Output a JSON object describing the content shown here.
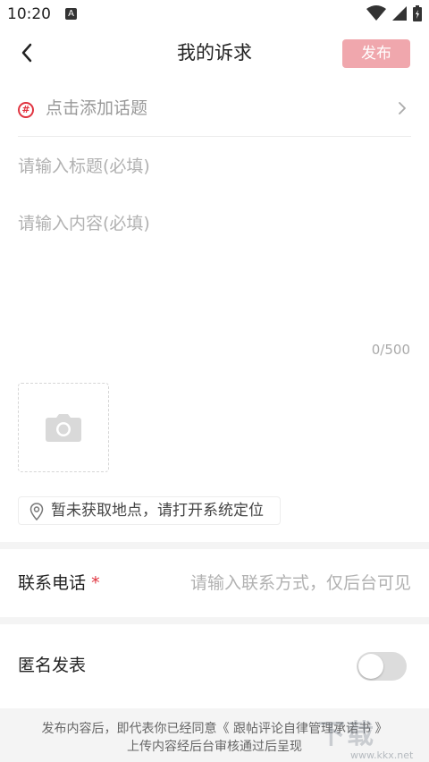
{
  "status_bar": {
    "time": "10:20",
    "notification_letter": "A",
    "icons": [
      "wifi-icon",
      "signal-icon",
      "battery-icon"
    ]
  },
  "header": {
    "title": "我的诉求",
    "publish_label": "发布",
    "icons": {
      "back": "chevron-left-icon"
    }
  },
  "topic": {
    "label": "点击添加话题",
    "hash_symbol": "#",
    "icons": {
      "topic": "hashtag-icon",
      "arrow": "chevron-right-icon"
    }
  },
  "form": {
    "title_placeholder": "请输入标题(必填)",
    "content_placeholder": "请输入内容(必填)",
    "char_counter": "0/500"
  },
  "media": {
    "icons": {
      "add_photo": "camera-icon"
    }
  },
  "location": {
    "text": "暂未获取地点，请打开系统定位",
    "icons": {
      "pin": "location-pin-icon"
    }
  },
  "contact": {
    "label": "联系电话",
    "required_mark": "*",
    "placeholder": "请输入联系方式，仅后台可见"
  },
  "anonymous": {
    "label": "匿名发表",
    "enabled": false
  },
  "footer": {
    "line1": "发布内容后，即代表你已经同意《 跟帖评论自律管理承诺书 》",
    "line2": "上传内容经后台审核通过后呈现"
  },
  "watermark": {
    "text": "下载",
    "url": "www.kkx.net"
  },
  "colors": {
    "accent_red": "#e0333f",
    "publish_button": "#f0a7ad"
  }
}
